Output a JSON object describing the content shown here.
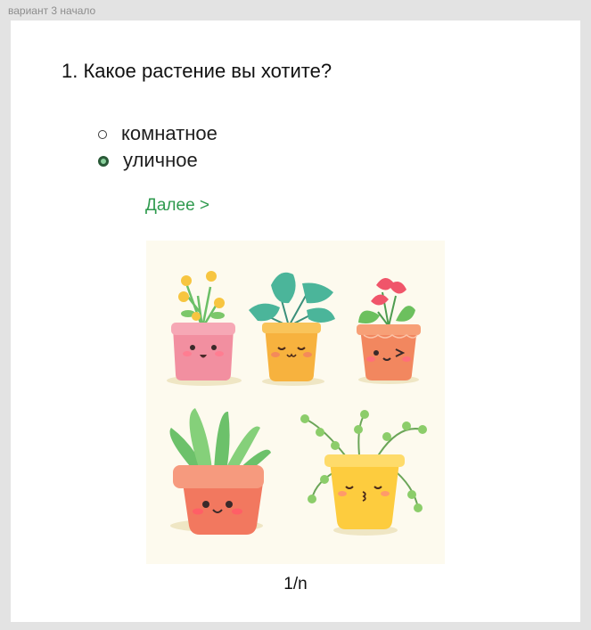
{
  "frame": {
    "label": "вариант 3 начало"
  },
  "question": {
    "text": "1. Какое растение вы хотите?"
  },
  "options": [
    {
      "label": "комнатное",
      "selected": false
    },
    {
      "label": "уличное",
      "selected": true
    }
  ],
  "next": {
    "label": "Далее >"
  },
  "pager": {
    "text": "1/n"
  },
  "colors": {
    "accent": "#2f9a4e",
    "radio_selected": "#2a5a38",
    "illustration_bg": "#fdfaee"
  }
}
